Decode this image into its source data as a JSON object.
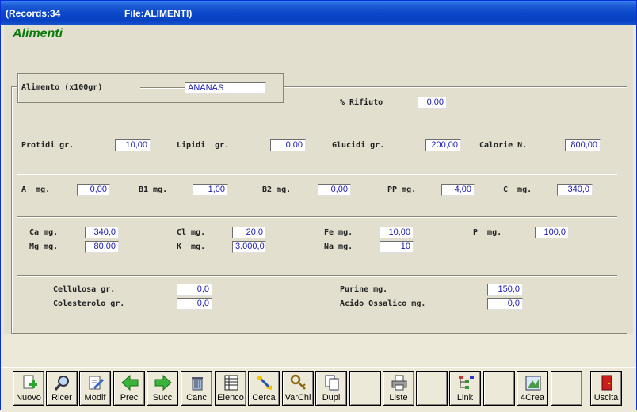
{
  "window": {
    "records_text": "(Records:34",
    "file_text": "File:ALIMENTI)"
  },
  "app_title": "Alimenti",
  "alimento": {
    "label": "Alimento (x100gr)",
    "value": "ANANAS"
  },
  "rifiuto": {
    "label": "% Rifiuto",
    "value": "0,00"
  },
  "row1": [
    {
      "label": "Protidi gr.",
      "value": "10,00"
    },
    {
      "label": "Lipidi  gr.",
      "value": "0,00"
    },
    {
      "label": "Glucidi gr.",
      "value": "200,00"
    },
    {
      "label": "Calorie N.",
      "value": "800,00"
    }
  ],
  "row2": [
    {
      "label": "A  mg.",
      "value": "0,00"
    },
    {
      "label": "B1 mg.",
      "value": "1,00"
    },
    {
      "label": "B2 mg.",
      "value": "0,00"
    },
    {
      "label": "PP mg.",
      "value": "4,00"
    },
    {
      "label": "C  mg.",
      "value": "340,0"
    }
  ],
  "row3": [
    {
      "label": "Ca mg.",
      "value": "340,0"
    },
    {
      "label": "Cl mg.",
      "value": "20,0"
    },
    {
      "label": "Fe mg.",
      "value": "10,00"
    },
    {
      "label": "P  mg.",
      "value": "100,0"
    },
    {
      "label": "Mg mg.",
      "value": "80,00"
    },
    {
      "label": "K  mg.",
      "value": "3.000,0"
    },
    {
      "label": "Na mg.",
      "value": "10"
    }
  ],
  "row4": [
    {
      "label": "Cellulosa gr.",
      "value": "0,0"
    },
    {
      "label": "Colesterolo gr.",
      "value": "0,0"
    },
    {
      "label": "Purine mg.",
      "value": "150,0"
    },
    {
      "label": "Acido Ossalico mg.",
      "value": "0,0"
    }
  ],
  "toolbar": {
    "buttons": [
      {
        "label": "Nuovo",
        "icon": "new-document-icon"
      },
      {
        "label": "Ricer",
        "icon": "magnifier-icon"
      },
      {
        "label": "Modif",
        "icon": "edit-document-icon"
      },
      {
        "label": "Prec",
        "icon": "arrow-left-icon"
      },
      {
        "label": "Succ",
        "icon": "arrow-right-icon"
      },
      {
        "label": "Canc",
        "icon": "trash-icon"
      },
      {
        "label": "Elenco",
        "icon": "list-icon"
      },
      {
        "label": "Cerca",
        "icon": "search-wand-icon"
      },
      {
        "label": "VarChi",
        "icon": "keys-icon"
      },
      {
        "label": "Dupl",
        "icon": "duplicate-icon"
      },
      {
        "label": "Liste",
        "icon": "printer-icon"
      },
      {
        "label": "Link",
        "icon": "link-tree-icon"
      },
      {
        "label": "4Crea",
        "icon": "create-icon"
      },
      {
        "label": "Uscita",
        "icon": "exit-door-icon"
      }
    ]
  },
  "colors": {
    "title_green": "#0A7A0A",
    "value_blue": "#1A1AB4",
    "titlebar_blue": "#0A47C8"
  }
}
